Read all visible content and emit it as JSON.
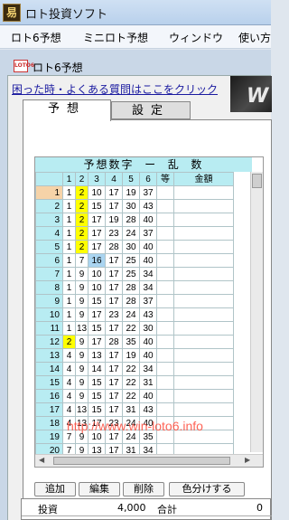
{
  "titlebar": {
    "app_icon_glyph": "易",
    "title": "ロト投資ソフト"
  },
  "menu": {
    "items": [
      "ロト6予想",
      "ミニロト予想",
      "ウィンドウ",
      "使い方"
    ]
  },
  "child": {
    "icon_label": "LOTO6",
    "title": "ロト6予想"
  },
  "help_link": "困った時・よくある質問はここをクリック",
  "banner_text": "W",
  "tabs": {
    "predict": "予想",
    "settings": "設定"
  },
  "grid": {
    "title": "予想数字  ー  乱  数",
    "headers": [
      "1",
      "2",
      "3",
      "4",
      "5",
      "6",
      "等",
      "金額"
    ],
    "rows": [
      {
        "n": "1",
        "v": [
          "1",
          "2",
          "10",
          "17",
          "19",
          "37"
        ]
      },
      {
        "n": "2",
        "v": [
          "1",
          "2",
          "15",
          "17",
          "30",
          "43"
        ]
      },
      {
        "n": "3",
        "v": [
          "1",
          "2",
          "17",
          "19",
          "28",
          "40"
        ]
      },
      {
        "n": "4",
        "v": [
          "1",
          "2",
          "17",
          "23",
          "24",
          "37"
        ]
      },
      {
        "n": "5",
        "v": [
          "1",
          "2",
          "17",
          "28",
          "30",
          "40"
        ]
      },
      {
        "n": "6",
        "v": [
          "1",
          "7",
          "16",
          "17",
          "25",
          "40"
        ]
      },
      {
        "n": "7",
        "v": [
          "1",
          "9",
          "10",
          "17",
          "25",
          "34"
        ]
      },
      {
        "n": "8",
        "v": [
          "1",
          "9",
          "10",
          "17",
          "28",
          "34"
        ]
      },
      {
        "n": "9",
        "v": [
          "1",
          "9",
          "15",
          "17",
          "28",
          "37"
        ]
      },
      {
        "n": "10",
        "v": [
          "1",
          "9",
          "17",
          "23",
          "24",
          "43"
        ]
      },
      {
        "n": "11",
        "v": [
          "1",
          "13",
          "15",
          "17",
          "22",
          "30"
        ]
      },
      {
        "n": "12",
        "v": [
          "2",
          "9",
          "17",
          "28",
          "35",
          "40"
        ]
      },
      {
        "n": "13",
        "v": [
          "4",
          "9",
          "13",
          "17",
          "19",
          "40"
        ]
      },
      {
        "n": "14",
        "v": [
          "4",
          "9",
          "14",
          "17",
          "22",
          "34"
        ]
      },
      {
        "n": "15",
        "v": [
          "4",
          "9",
          "15",
          "17",
          "22",
          "31"
        ]
      },
      {
        "n": "16",
        "v": [
          "4",
          "9",
          "15",
          "17",
          "22",
          "40"
        ]
      },
      {
        "n": "17",
        "v": [
          "4",
          "13",
          "15",
          "17",
          "31",
          "43"
        ]
      },
      {
        "n": "18",
        "v": [
          "4",
          "13",
          "17",
          "23",
          "24",
          "40"
        ]
      },
      {
        "n": "19",
        "v": [
          "7",
          "9",
          "10",
          "17",
          "24",
          "35"
        ]
      },
      {
        "n": "20",
        "v": [
          "7",
          "9",
          "13",
          "17",
          "31",
          "34"
        ]
      }
    ],
    "highlight_color": "#ffff00",
    "selected_color": "#a9d4f0"
  },
  "watermark": "http://www.win-loto6.info",
  "buttons": {
    "add": "追加",
    "edit": "編集",
    "delete": "削除",
    "color": "色分けする"
  },
  "footer": {
    "invest_label": "投資",
    "invest_value": "4,000",
    "total_label": "合計",
    "total_value": "0"
  }
}
